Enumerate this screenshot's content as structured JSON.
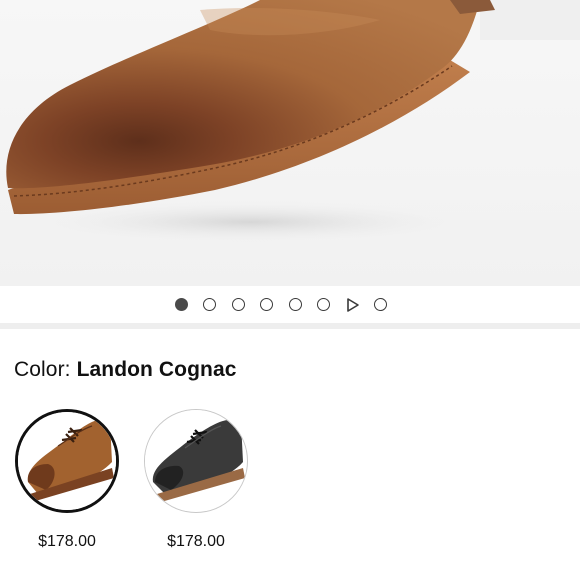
{
  "gallery": {
    "image_icon": "shoe-toe-closeup-image",
    "slide_count": 8,
    "active_index": 0,
    "video_index": 6
  },
  "color": {
    "label": "Color:",
    "selected_name": "Landon Cognac"
  },
  "swatches": [
    {
      "name": "cognac-shoe-thumbnail",
      "price": "$178.00",
      "selected": true
    },
    {
      "name": "black-shoe-thumbnail",
      "price": "$178.00",
      "selected": false
    }
  ],
  "colors": {
    "cognac": "#9a5a2e",
    "black": "#2a2a2a",
    "divider": "#eeeeee"
  }
}
